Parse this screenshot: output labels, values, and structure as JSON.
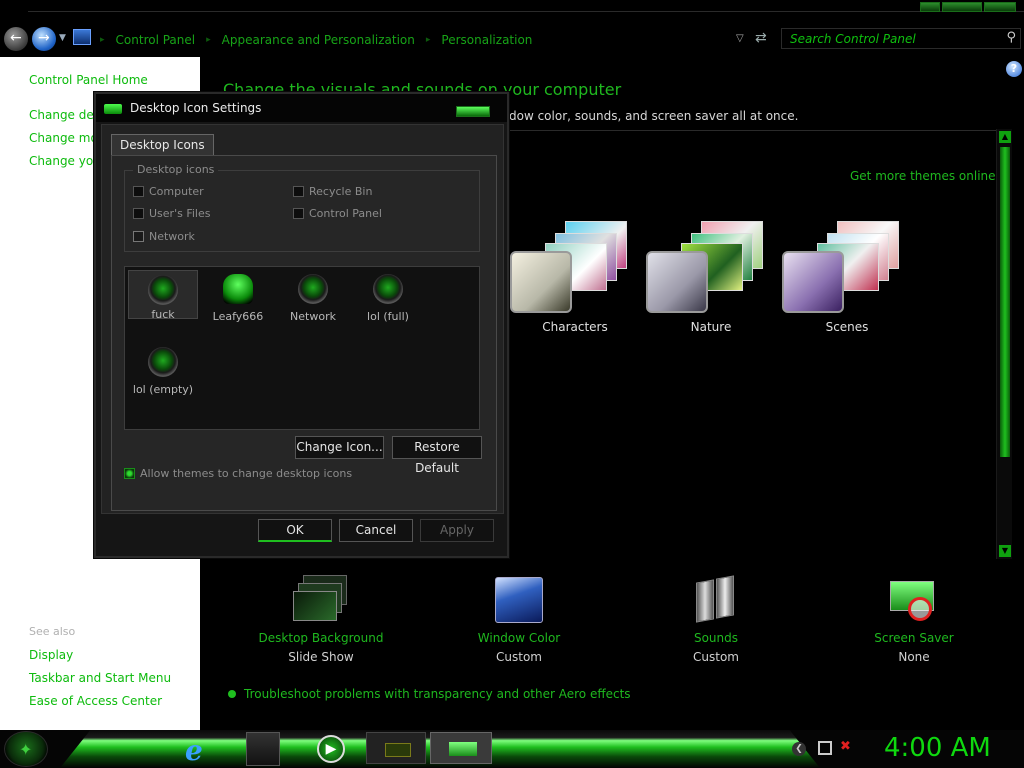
{
  "address_bar": {
    "breadcrumb": [
      "Control Panel",
      "Appearance and Personalization",
      "Personalization"
    ],
    "search_placeholder": "Search Control Panel"
  },
  "left_pane": {
    "home_link": "Control Panel Home",
    "tasks": [
      "Change des",
      "Change mo",
      "Change you"
    ],
    "see_also_heading": "See also",
    "see_also": [
      "Display",
      "Taskbar and Start Menu",
      "Ease of Access Center"
    ]
  },
  "content": {
    "title": "Change the visuals and sounds on your computer",
    "description": "dow color, sounds, and screen saver all at once.",
    "get_more_themes": "Get more themes online",
    "themes": [
      {
        "label": "Characters"
      },
      {
        "label": "Nature"
      },
      {
        "label": "Scenes"
      }
    ],
    "bottom_items": [
      {
        "title": "Desktop Background",
        "subtitle": "Slide Show",
        "icon": "desktop-background-icon"
      },
      {
        "title": "Window Color",
        "subtitle": "Custom",
        "icon": "window-color-icon"
      },
      {
        "title": "Sounds",
        "subtitle": "Custom",
        "icon": "sounds-icon"
      },
      {
        "title": "Screen Saver",
        "subtitle": "None",
        "icon": "screen-saver-icon"
      }
    ],
    "troubleshoot_link": "Troubleshoot problems with transparency and other Aero effects"
  },
  "dialog": {
    "title": "Desktop Icon Settings",
    "tab": "Desktop Icons",
    "group_label": "Desktop icons",
    "checkboxes": [
      {
        "label": "Computer",
        "checked": false
      },
      {
        "label": "Recycle Bin",
        "checked": false
      },
      {
        "label": "User's Files",
        "checked": false
      },
      {
        "label": "Control Panel",
        "checked": false
      },
      {
        "label": "Network",
        "checked": true
      }
    ],
    "icons": [
      {
        "label": "fuck",
        "selected": true
      },
      {
        "label": "Leafy666",
        "selected": false
      },
      {
        "label": "Network",
        "selected": false
      },
      {
        "label": "lol (full)",
        "selected": false
      },
      {
        "label": "lol (empty)",
        "selected": false
      }
    ],
    "change_icon_button": "Change Icon...",
    "restore_default_button": "Restore Default",
    "allow_themes_label": "Allow themes to change desktop icons",
    "allow_themes_checked": true,
    "ok_button": "OK",
    "cancel_button": "Cancel",
    "apply_button": "Apply"
  },
  "taskbar": {
    "clock": "4:00 AM"
  },
  "colors": {
    "accent_green": "#1fbf1f",
    "left_pane_bg": "#ffffff",
    "content_bg": "#000000"
  }
}
